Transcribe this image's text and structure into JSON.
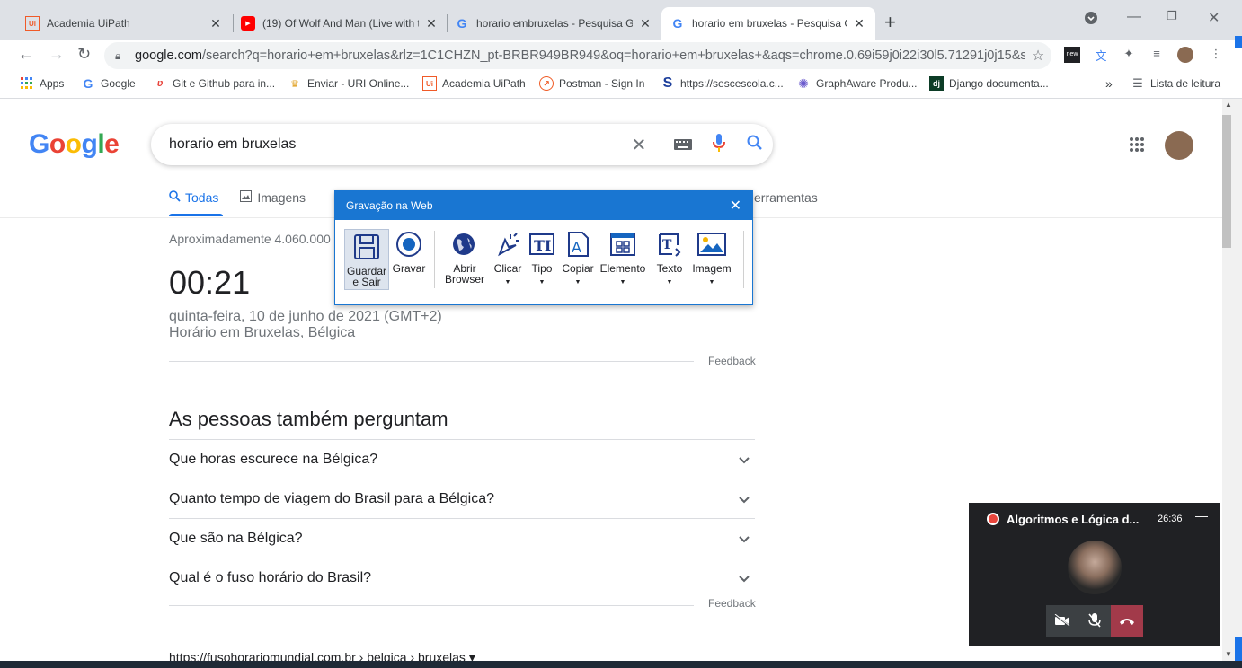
{
  "tabs": [
    {
      "title": "Academia UiPath",
      "favicon": "Ui",
      "active": false
    },
    {
      "title": "(19) Of Wolf And Man (Live with t",
      "favicon": "yt",
      "active": false
    },
    {
      "title": "horario embruxelas - Pesquisa Go",
      "favicon": "G",
      "active": false
    },
    {
      "title": "horario em bruxelas - Pesquisa G",
      "favicon": "G",
      "active": true
    }
  ],
  "toolbar": {
    "url_host": "google.com",
    "url_path": "/search?q=horario+em+bruxelas&rlz=1C1CHZN_pt-BRBR949BR949&oq=horario+em+bruxelas+&aqs=chrome.0.69i59j0i22i30l5.71291j0j15&so..."
  },
  "bookmarks": {
    "items": [
      {
        "label": "Apps",
        "icon": "apps-grid-icon"
      },
      {
        "label": "Google",
        "icon": "google-icon"
      },
      {
        "label": "Git e Github para in...",
        "icon": "udemy-icon"
      },
      {
        "label": "Enviar - URI Online...",
        "icon": "trophy-icon"
      },
      {
        "label": "Academia UiPath",
        "icon": "uipath-icon"
      },
      {
        "label": "Postman - Sign In",
        "icon": "postman-icon"
      },
      {
        "label": "https://sescescola.c...",
        "icon": "s-icon"
      },
      {
        "label": "GraphAware Produ...",
        "icon": "graphaware-icon"
      },
      {
        "label": "Django documenta...",
        "icon": "django-icon"
      }
    ],
    "more": "»",
    "reading_list": "Lista de leitura"
  },
  "google": {
    "logo": "Google",
    "query": "horario em bruxelas",
    "tabs": [
      {
        "label": "Todas",
        "icon": "search-icon"
      },
      {
        "label": "Imagens",
        "icon": "image-icon"
      }
    ],
    "tools_label": "Ferramentas",
    "tools_visible": "erramentas",
    "stats": "Aproximadamente 4.060.000",
    "time": "00:21",
    "date_line": "quinta-feira, 10 de junho de 2021 (GMT+2)",
    "place_line": "Horário em Bruxelas, Bélgica",
    "feedback": "Feedback",
    "paa_title": "As pessoas também perguntam",
    "paa": [
      "Que horas escurece na Bélgica?",
      "Quanto tempo de viagem do Brasil para a Bélgica?",
      "Que são na Bélgica?",
      "Qual é o fuso horário do Brasil?"
    ],
    "cite": "https://fusohorariomundial.com.br › belgica › bruxelas ▾"
  },
  "recorder": {
    "title": "Gravação na Web",
    "tools": [
      {
        "label": "Guardar e Sair",
        "icon": "save-icon"
      },
      {
        "label": "Gravar",
        "icon": "record-icon"
      },
      {
        "label": "Abrir Browser",
        "icon": "globe-icon"
      },
      {
        "label": "Clicar",
        "icon": "click-icon"
      },
      {
        "label": "Tipo",
        "icon": "type-icon"
      },
      {
        "label": "Copiar",
        "icon": "copy-icon"
      },
      {
        "label": "Elemento",
        "icon": "element-icon"
      },
      {
        "label": "Texto",
        "icon": "text-icon"
      },
      {
        "label": "Imagem",
        "icon": "image-icon"
      }
    ]
  },
  "meeting": {
    "title": "Algoritmos e Lógica d...",
    "elapsed": "26:36"
  },
  "colors": {
    "accent": "#1a73e8",
    "recorder_blue": "#1976d2",
    "meet_bg": "#202124",
    "end_call": "#a23a4a"
  }
}
